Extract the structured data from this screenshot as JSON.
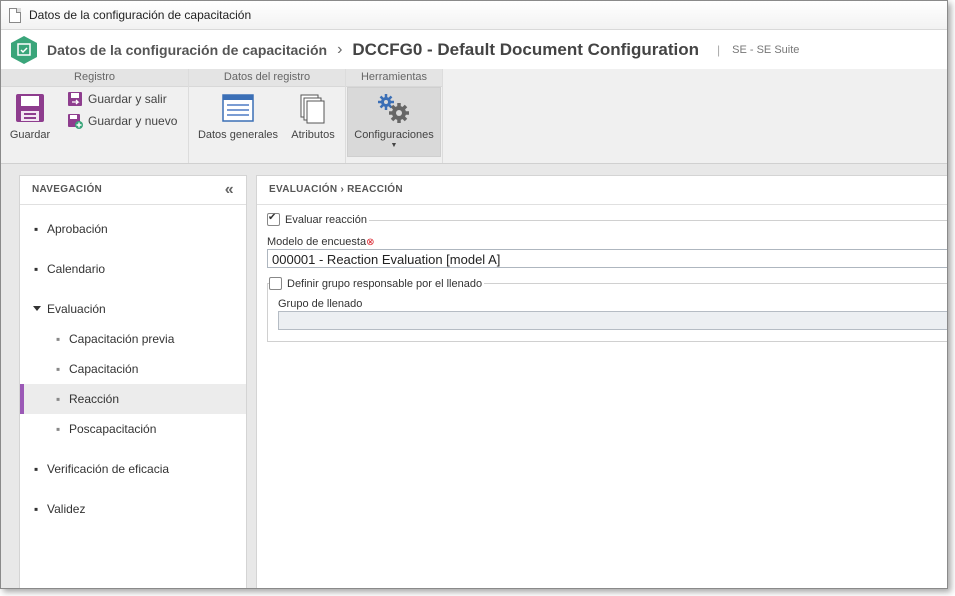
{
  "window": {
    "title": "Datos de la configuración de capacitación"
  },
  "header": {
    "breadcrumb": "Datos de la configuración de capacitación",
    "separator": "›",
    "doc_title": "DCCFG0 - Default Document Configuration",
    "pipe": "|",
    "suite": "SE - SE Suite"
  },
  "ribbon": {
    "groups": {
      "registro": "Registro",
      "datos_registro": "Datos del registro",
      "herramientas": "Herramientas"
    },
    "buttons": {
      "guardar": "Guardar",
      "guardar_salir": "Guardar y salir",
      "guardar_nuevo": "Guardar y nuevo",
      "datos_generales": "Datos generales",
      "atributos": "Atributos",
      "configuraciones": "Configuraciones"
    },
    "caret": "▼"
  },
  "nav": {
    "heading": "NAVEGACIÓN",
    "collapse": "«",
    "items": [
      "Aprobación",
      "Calendario",
      "Evaluación",
      "Capacitación previa",
      "Capacitación",
      "Reacción",
      "Poscapacitación",
      "Verificación de eficacia",
      "Validez"
    ],
    "bullet": "▪"
  },
  "main": {
    "breadcrumb": "EVALUACIÓN  ›  REACCIÓN",
    "evaluar_reaccion": "Evaluar reacción",
    "modelo_label": "Modelo de encuesta",
    "required_mark": "⊗",
    "modelo_value": "000001 - Reaction Evaluation [model A]",
    "definir_grupo": "Definir grupo responsable por el llenado",
    "grupo_label": "Grupo de llenado",
    "grupo_value": ""
  },
  "colors": {
    "accent": "#9b59b6",
    "logo": "#3aa57a"
  }
}
